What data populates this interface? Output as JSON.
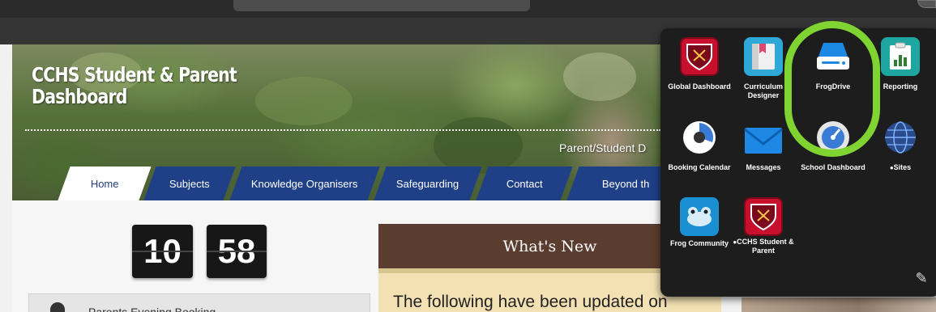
{
  "banner": {
    "title": "CCHS Student & Parent Dashboard",
    "subtitle": "Parent/Student D"
  },
  "tabs": [
    {
      "label": "Home",
      "active": true
    },
    {
      "label": "Subjects"
    },
    {
      "label": "Knowledge Organisers"
    },
    {
      "label": "Safeguarding"
    },
    {
      "label": "Contact"
    },
    {
      "label": "Beyond th"
    }
  ],
  "clock": {
    "hours": "10",
    "minutes": "58"
  },
  "booking": {
    "label": "Parents Evening Booking"
  },
  "whats_new": {
    "heading": "What's New",
    "text": "The following have been updated on"
  },
  "app_launcher": {
    "apps": [
      {
        "label": "Global Dashboard",
        "icon": "shield-crest-icon"
      },
      {
        "label": "Curriculum Designer",
        "icon": "book-icon"
      },
      {
        "label": "FrogDrive",
        "icon": "drive-icon",
        "highlighted": true
      },
      {
        "label": "Reporting",
        "icon": "report-chart-icon"
      },
      {
        "label": "Booking Calendar",
        "icon": "clock-icon"
      },
      {
        "label": "Messages",
        "icon": "envelope-icon"
      },
      {
        "label": "School Dashboard",
        "icon": "gauge-icon"
      },
      {
        "label": "Sites",
        "icon": "globe-icon"
      },
      {
        "label": "Frog Community",
        "icon": "frog-icon"
      },
      {
        "label": "CCHS Student & Parent",
        "icon": "shield-crest-icon"
      }
    ],
    "edit_icon": "pencil-icon"
  },
  "colors": {
    "topbar": "#2b2b2b",
    "tab_blue": "#1f3f86",
    "whats_new_header": "#5b3d2f",
    "whats_new_body": "#f3e1b3",
    "launcher_bg": "#1d1d1d",
    "highlight": "#7fd431"
  }
}
